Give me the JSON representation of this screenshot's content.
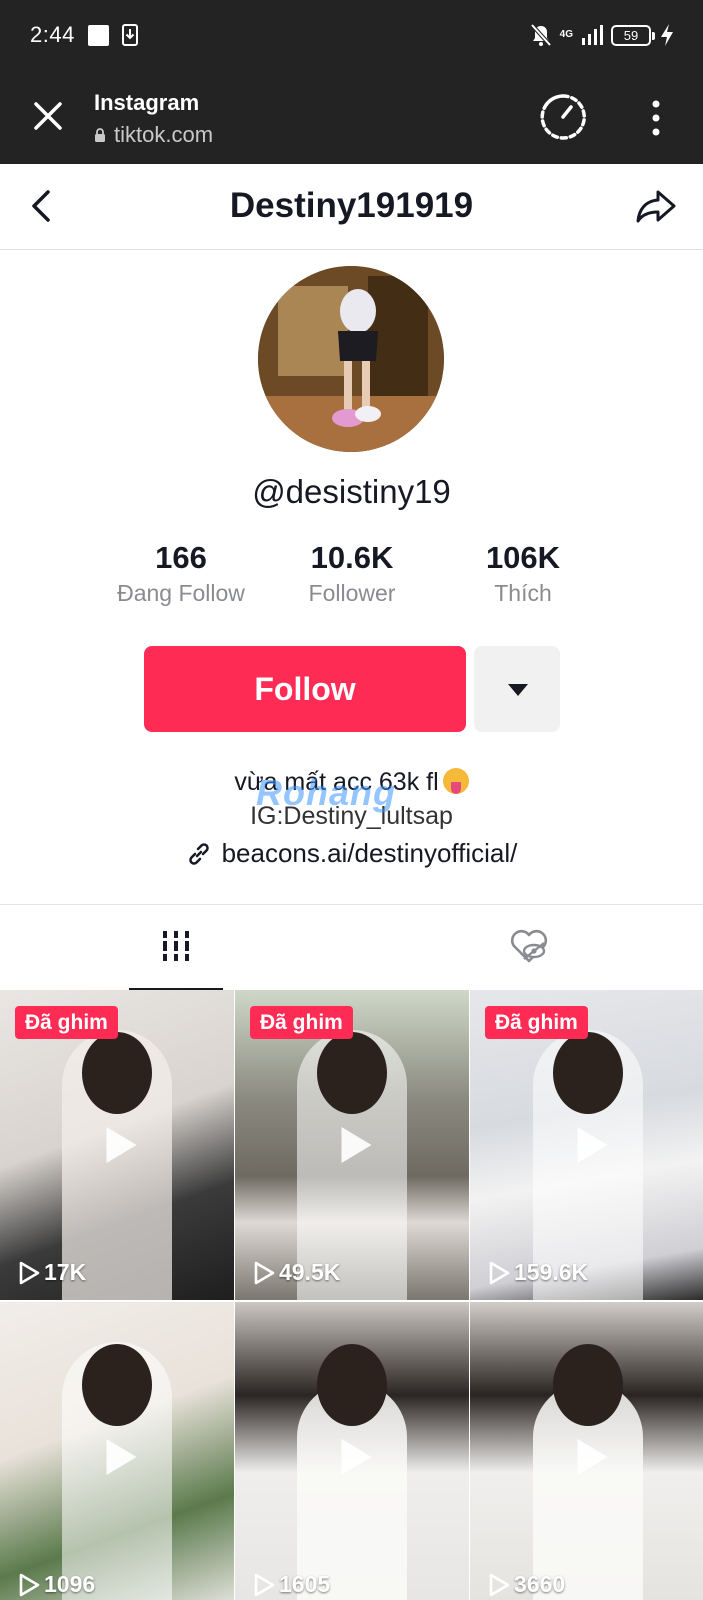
{
  "status_bar": {
    "time": "2:44",
    "network": "4G",
    "battery": "59"
  },
  "browser": {
    "title": "Instagram",
    "url": "tiktok.com"
  },
  "header": {
    "title": "Destiny191919"
  },
  "profile": {
    "username": "@desistiny19",
    "stats": [
      {
        "value": "166",
        "label": "Đang Follow"
      },
      {
        "value": "10.6K",
        "label": "Follower"
      },
      {
        "value": "106K",
        "label": "Thích"
      }
    ],
    "follow_label": "Follow",
    "bio_line1": "vừa mất acc 63k fl",
    "bio_line2": "IG:Destiny_lultsap",
    "link": "beacons.ai/destinyofficial/",
    "watermark_a": "Ro",
    "watermark_b": "hang"
  },
  "videos": [
    {
      "pinned": "Đã ghim",
      "views": "17K"
    },
    {
      "pinned": "Đã ghim",
      "views": "49.5K"
    },
    {
      "pinned": "Đã ghim",
      "views": "159.6K"
    },
    {
      "pinned": "",
      "views": "1096"
    },
    {
      "pinned": "",
      "views": "1605"
    },
    {
      "pinned": "",
      "views": "3660"
    }
  ],
  "colors": {
    "accent": "#fe2c55",
    "chrome": "#232323",
    "text": "#161823",
    "muted": "#8a8b91"
  }
}
